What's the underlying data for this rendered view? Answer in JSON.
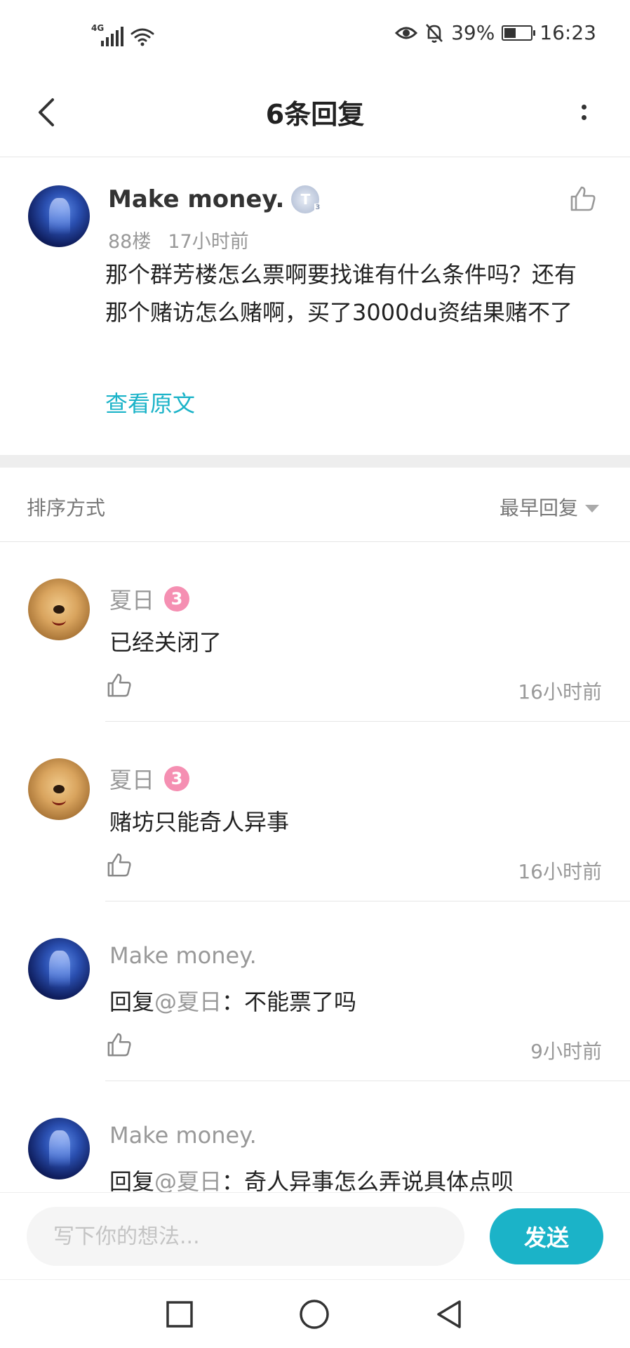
{
  "status_bar": {
    "network": "4G",
    "battery": "39%",
    "time": "16:23"
  },
  "header": {
    "title": "6条回复"
  },
  "post": {
    "author": "Make money.",
    "badge": "T",
    "badge_level": "3",
    "floor": "88楼",
    "time": "17小时前",
    "content": "那个群芳楼怎么票啊要找谁有什么条件吗？还有那个赌访怎么赌啊，买了3000du资结果赌不了",
    "view_original": "查看原文"
  },
  "sort": {
    "label": "排序方式",
    "value": "最早回复"
  },
  "replies": [
    {
      "author": "夏日",
      "badge": "3",
      "prefix": "",
      "mention": "",
      "text": "已经关闭了",
      "time": "16小时前"
    },
    {
      "author": "夏日",
      "badge": "3",
      "prefix": "",
      "mention": "",
      "text": "赌坊只能奇人异事",
      "time": "16小时前"
    },
    {
      "author": "Make money.",
      "badge": "",
      "prefix": "回复",
      "mention": "@夏日",
      "text": "：不能票了吗",
      "time": "9小时前"
    },
    {
      "author": "Make money.",
      "badge": "",
      "prefix": "回复",
      "mention": "@夏日",
      "text": "：奇人异事怎么弄说具体点呗",
      "time": ""
    }
  ],
  "input": {
    "placeholder": "写下你的想法...",
    "send_label": "发送"
  },
  "colors": {
    "accent": "#1bb3c8",
    "badge_pink": "#f58fb2"
  },
  "icons": {
    "back": "chevron-left-icon",
    "more": "more-vertical-icon",
    "like": "thumbs-up-icon"
  }
}
